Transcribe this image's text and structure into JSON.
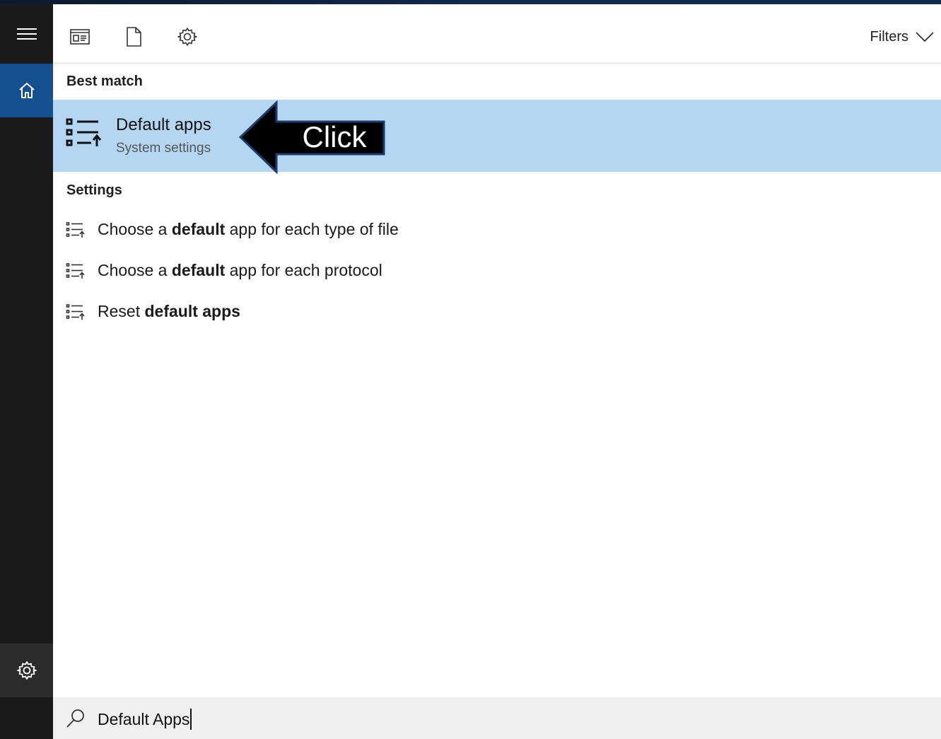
{
  "toolbar": {
    "filters_label": "Filters"
  },
  "sections": {
    "best_match_label": "Best match",
    "settings_label": "Settings"
  },
  "best_match": {
    "title": "Default apps",
    "subtitle": "System settings"
  },
  "callout": {
    "text": "Click"
  },
  "results": [
    {
      "pre": "Choose a ",
      "bold": "default",
      "post": " app for each type of file"
    },
    {
      "pre": "Choose a ",
      "bold": "default",
      "post": " app for each protocol"
    },
    {
      "pre": "Reset ",
      "bold": "default apps",
      "post": ""
    }
  ],
  "search": {
    "value": "Default Apps"
  },
  "colors": {
    "rail": "#1a1a1a",
    "home_active": "#14508f",
    "selection": "#b3d7f2",
    "callout_fill": "#000000",
    "callout_border": "#1f3a6b"
  },
  "icons": {
    "menu": "hamburger-icon",
    "home": "home-icon",
    "rail_settings": "gear-icon",
    "apps_filter": "apps-icon",
    "documents_filter": "document-icon",
    "settings_filter": "gear-icon",
    "filters_chevron": "chevron-down-icon",
    "setting_item": "list-settings-icon",
    "search": "search-icon"
  }
}
